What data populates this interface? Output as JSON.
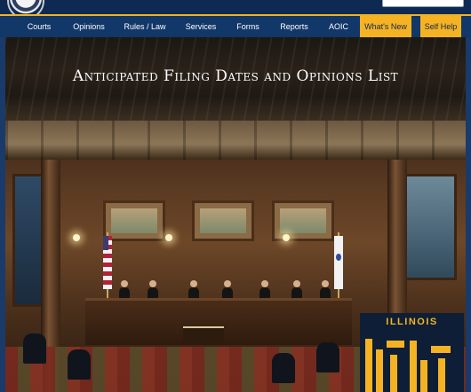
{
  "nav": {
    "items": [
      {
        "label": "Courts"
      },
      {
        "label": "Opinions"
      },
      {
        "label": "Rules / Law"
      },
      {
        "label": "Services"
      },
      {
        "label": "Forms"
      },
      {
        "label": "Reports"
      },
      {
        "label": "AOIC"
      }
    ],
    "highlight": [
      {
        "label": "What's New"
      },
      {
        "label": "Self Help"
      }
    ]
  },
  "hero": {
    "title": "Anticipated Filing Dates and Opinions List"
  },
  "badge": {
    "text": "ILLINOIS"
  },
  "colors": {
    "nav_bg": "#123769",
    "accent": "#f5b324",
    "header_bg": "#0f2a52"
  }
}
